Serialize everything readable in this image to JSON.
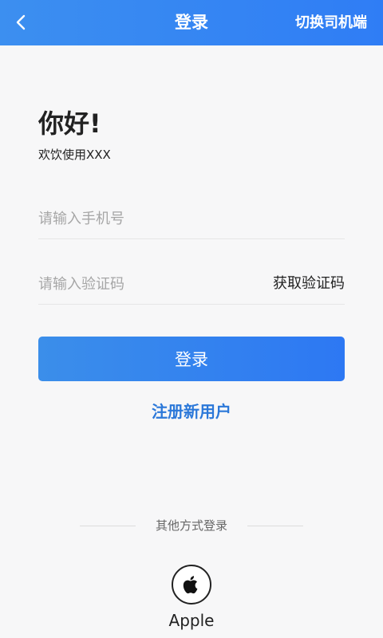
{
  "header": {
    "title": "登录",
    "switch_label": "切换司机端",
    "back_icon": "chevron-left-icon"
  },
  "greeting": {
    "title": "你好!",
    "subtitle": "欢饮使用XXX"
  },
  "form": {
    "phone_placeholder": "请输入手机号",
    "code_placeholder": "请输入验证码",
    "get_code_label": "获取验证码",
    "login_label": "登录",
    "register_label": "注册新用户"
  },
  "other_login": {
    "label": "其他方式登录",
    "apple_label": "Apple",
    "apple_icon": "apple-logo-icon"
  },
  "colors": {
    "primary": "#2f7df5",
    "link": "#2b78d9"
  }
}
